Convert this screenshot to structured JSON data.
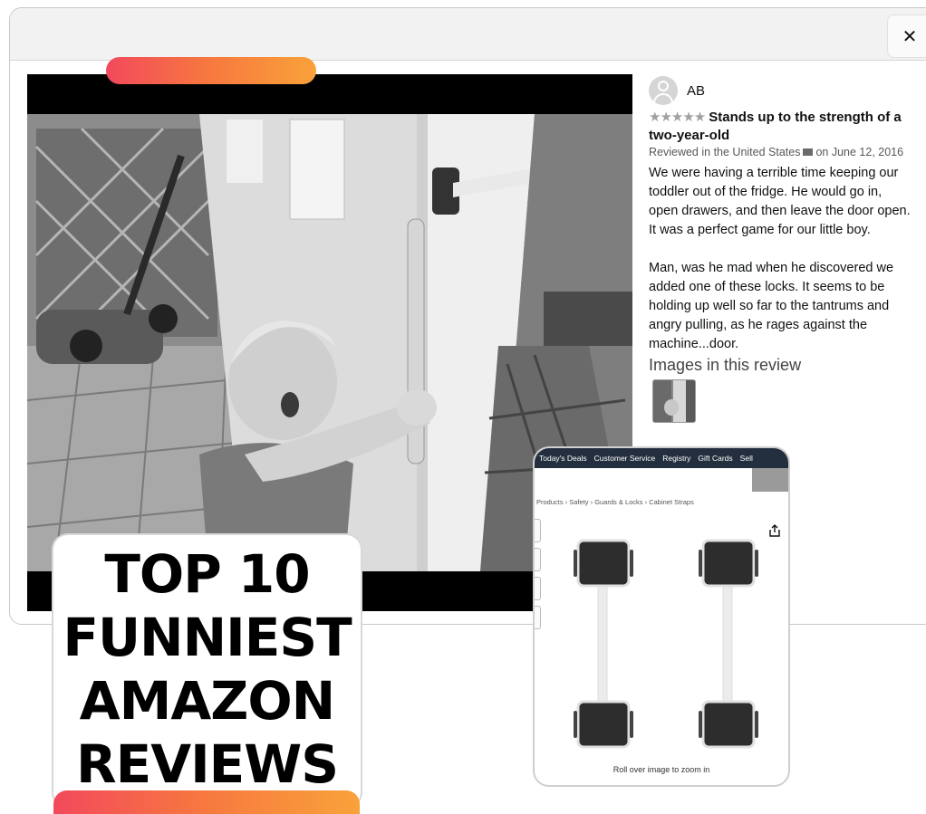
{
  "modal": {
    "close_label": "✕",
    "reviewer": {
      "name": "AB"
    },
    "review": {
      "stars": "★★★★★",
      "title": "Stands up to the strength of a two-year-old",
      "meta_prefix": "Reviewed in the United States",
      "meta_suffix": "on June 12, 2016",
      "paragraphs": [
        "We were having a terrible time keeping our toddler out of the fridge. He would go in, open drawers, and then leave the door open. It was a perfect game for our little boy.",
        "Man, was he mad when he discovered we added one of these locks. It seems to be holding up well so far to the tantrums and angry pulling, as he rages against the machine...door."
      ]
    },
    "images_heading": "Images in this review"
  },
  "title_card": {
    "lines": [
      "TOP 10",
      "FUNNIEST",
      "AMAZON",
      "REVIEWS"
    ]
  },
  "product_panel": {
    "nav": [
      "Today's Deals",
      "Customer Service",
      "Registry",
      "Gift Cards",
      "Sell"
    ],
    "breadcrumb": "Products › Safety › Guards & Locks › Cabinet Straps",
    "zoom_hint": "Roll over image to zoom in"
  },
  "colors": {
    "bar_start": "#f2495c",
    "bar_mid": "#f7793f",
    "bar_end": "#f9a23a",
    "amazon_nav": "#232f3e"
  },
  "icons": {
    "close": "close-icon",
    "avatar": "user-avatar-icon",
    "share": "share-icon",
    "flag": "us-flag-icon"
  }
}
